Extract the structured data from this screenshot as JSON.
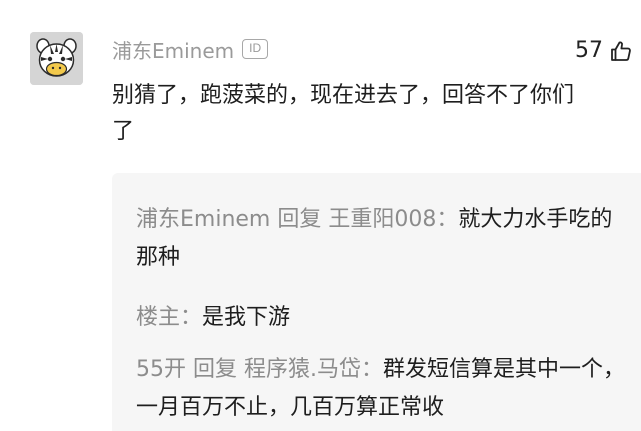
{
  "comment": {
    "username": "浦东Eminem",
    "id_badge": "ID",
    "like_count": "57",
    "content": "别猜了，跑菠菜的，现在进去了，回答不了你们了"
  },
  "replies": [
    {
      "author": "浦东Eminem",
      "op": "回复",
      "target": "王重阳008",
      "colon": "：",
      "text": "就大力水手吃的那种"
    },
    {
      "author": "楼主",
      "colon": "：",
      "text": "是我下游"
    },
    {
      "author": "55开",
      "op": "回复",
      "target": "程序猿.马岱",
      "colon": "：",
      "text": "群发短信算是其中一个，一月百万不止，几百万算正常收"
    }
  ],
  "icons": {
    "avatar": "zebra-avatar-icon",
    "like": "thumbs-up-icon",
    "badge": "id-badge-icon"
  },
  "colors": {
    "username": "#9a9a9a",
    "reply_panel": "#f6f6f6",
    "text": "#1e1e1e"
  }
}
